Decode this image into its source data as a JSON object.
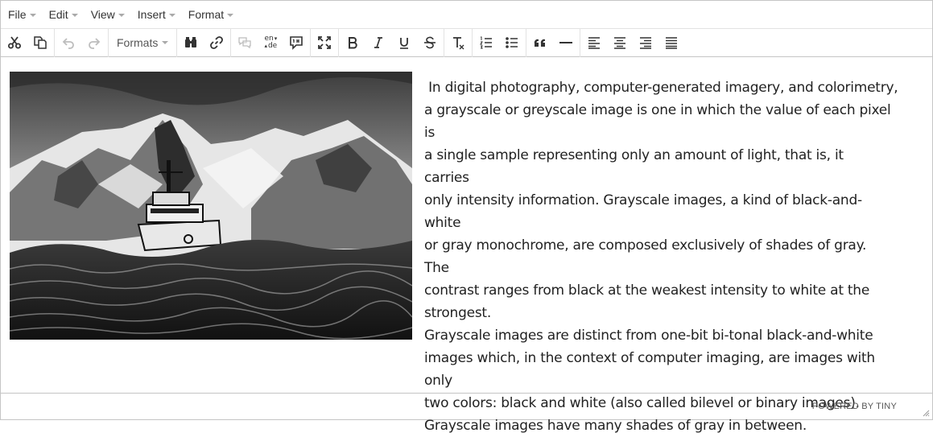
{
  "menubar": {
    "items": [
      {
        "label": "File"
      },
      {
        "label": "Edit"
      },
      {
        "label": "View"
      },
      {
        "label": "Insert"
      },
      {
        "label": "Format"
      }
    ]
  },
  "toolbar": {
    "formats_label": "Formats",
    "lang_top": "en",
    "lang_bottom": "de",
    "icons": [
      "cut-icon",
      "copy-icon",
      "undo-icon",
      "redo-icon",
      "find-icon",
      "link-icon",
      "comment-icon",
      "language-icon",
      "text-direction-icon",
      "fullscreen-icon",
      "bold-icon",
      "italic-icon",
      "underline-icon",
      "strikethrough-icon",
      "clear-formatting-icon",
      "numbered-list-icon",
      "bullet-list-icon",
      "blockquote-icon",
      "horizontal-rule-icon",
      "align-left-icon",
      "align-center-icon",
      "align-right-icon",
      "justify-icon"
    ]
  },
  "content": {
    "image_subject": "grayscale-photo-boat-in-waves-with-mountains",
    "lines": [
      " In digital photography, computer-generated imagery, and colorimetry,",
      "a grayscale or greyscale image is one in which the value of each pixel is",
      "a single sample representing only an amount of light, that is, it carries",
      "only intensity information. Grayscale images, a kind of black-and-white",
      "or gray monochrome, are composed exclusively of shades of gray. The",
      "contrast ranges from black at the weakest intensity to white at the",
      "strongest.",
      "Grayscale images are distinct from one-bit bi-tonal black-and-white",
      "images which, in the context of computer imaging, are images with only",
      "two colors: black and white (also called bilevel or binary images).",
      "Grayscale images have many shades of gray in between."
    ]
  },
  "statusbar": {
    "powered_by": "POWERED BY TINY"
  }
}
